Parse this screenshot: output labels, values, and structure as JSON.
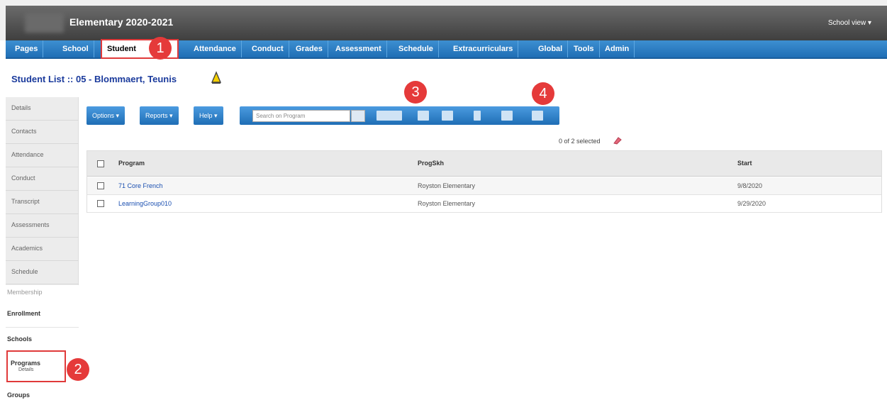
{
  "header": {
    "title": "Elementary 2020-2021",
    "school_view": "School view ▾"
  },
  "nav": {
    "tabs": [
      "Pages",
      "School",
      "Student",
      "Attendance",
      "Conduct",
      "Grades",
      "Assessment",
      "Schedule",
      "Extracurriculars",
      "Global",
      "Tools",
      "Admin"
    ],
    "active": "Student"
  },
  "page_title": "Student List :: 05 - Blommaert, Teunis",
  "sidenav": {
    "items": [
      "Details",
      "Contacts",
      "Attendance",
      "Conduct",
      "Transcript",
      "Assessments",
      "Academics",
      "Schedule"
    ],
    "section_label": "Membership",
    "sub_items": [
      "Enrollment",
      "Schools",
      "Groups"
    ],
    "programs_label": "Programs",
    "programs_sub": "Details"
  },
  "callouts": [
    "1",
    "2",
    "3",
    "4"
  ],
  "toolbar": {
    "options_label": "Options ▾",
    "reports_label": "Reports ▾",
    "help_label": "Help ▾",
    "search_placeholder": "Search on Program"
  },
  "selected_count": "0 of 2 selected",
  "table": {
    "headers": [
      "Program",
      "ProgSkh",
      "Start"
    ],
    "rows": [
      {
        "program": "71 Core French",
        "school": "Royston Elementary",
        "start": "9/8/2020"
      },
      {
        "program": "LearningGroup010",
        "school": "Royston Elementary",
        "start": "9/29/2020"
      }
    ]
  },
  "colors": {
    "nav_blue": "#1f6eb5",
    "callout_red": "#e53a3a",
    "title_blue": "#1a3a9c"
  }
}
